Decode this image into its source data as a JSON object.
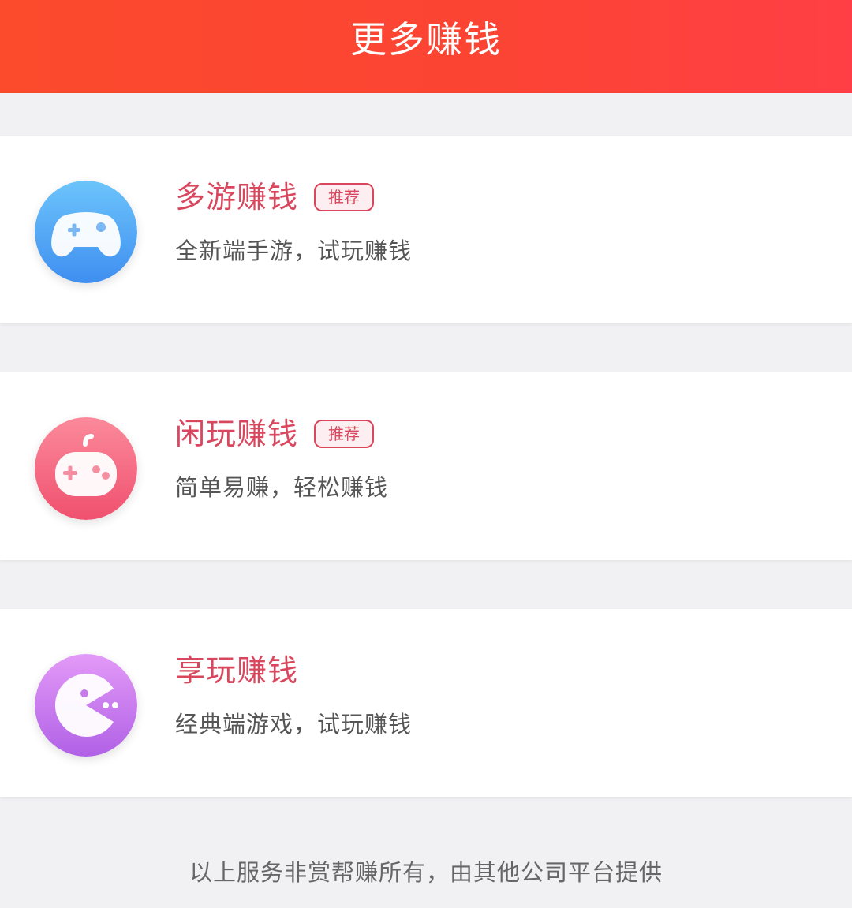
{
  "header": {
    "title": "更多赚钱",
    "accent_color": "#fc4433"
  },
  "items": [
    {
      "title": "多游赚钱",
      "badge": "推荐",
      "description": "全新端手游，试玩赚钱",
      "icon": "gamepad-icon",
      "icon_color": "#4aa8f5"
    },
    {
      "title": "闲玩赚钱",
      "badge": "推荐",
      "description": "简单易赚，轻松赚钱",
      "icon": "game-controller-icon",
      "icon_color": "#f5677f"
    },
    {
      "title": "享玩赚钱",
      "description": "经典端游戏，试玩赚钱",
      "icon": "pacman-icon",
      "icon_color": "#c877ee"
    }
  ],
  "footer": {
    "note": "以上服务非赏帮赚所有，由其他公司平台提供"
  },
  "colors": {
    "title_pink": "#d9475e",
    "page_background": "#f1f1f4"
  }
}
